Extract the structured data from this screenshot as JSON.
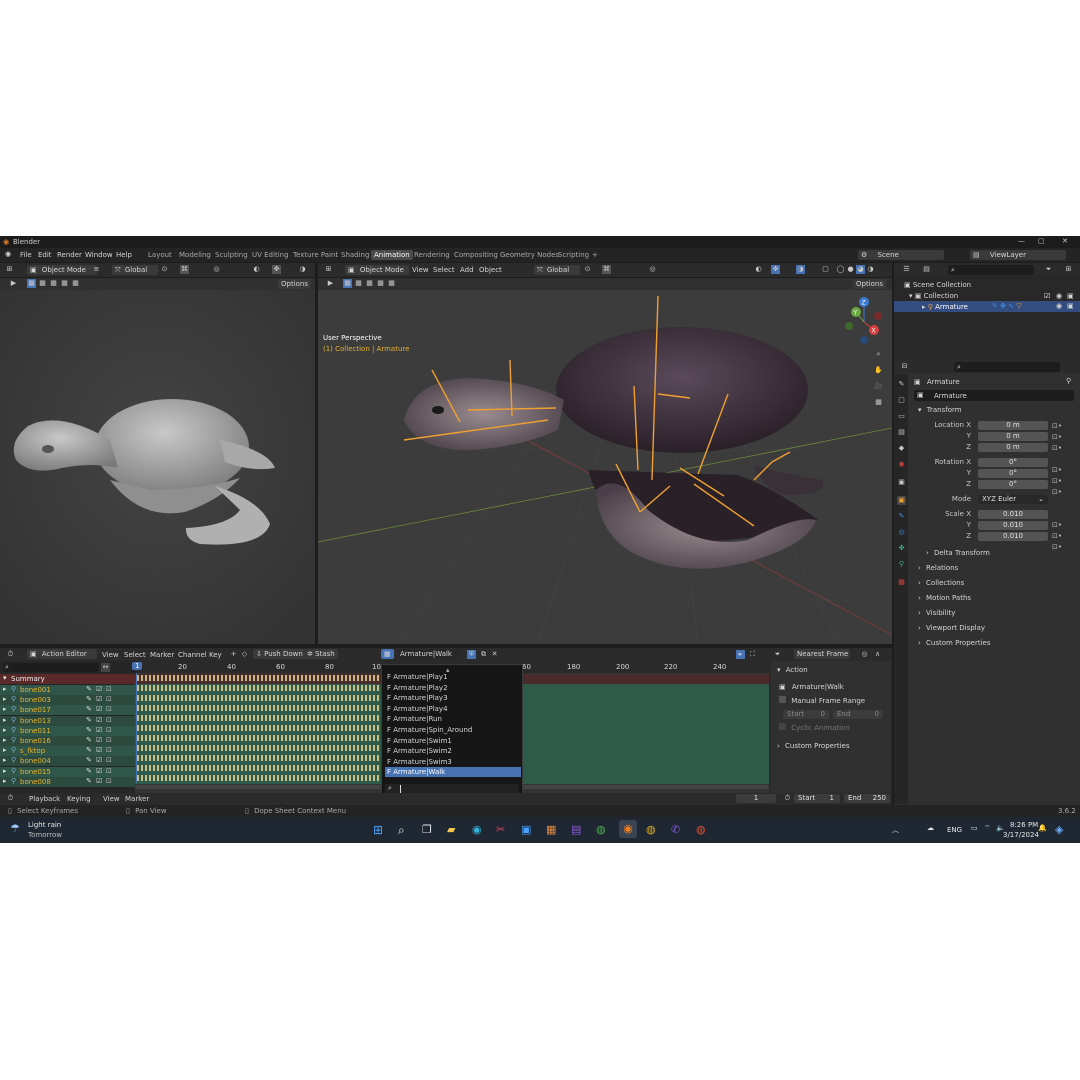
{
  "window": {
    "title": "Blender"
  },
  "menus": [
    "File",
    "Edit",
    "Render",
    "Window",
    "Help"
  ],
  "workspaces": [
    "Layout",
    "Modeling",
    "Sculpting",
    "UV Editing",
    "Texture Paint",
    "Shading",
    "Animation",
    "Rendering",
    "Compositing",
    "Geometry Nodes",
    "Scripting"
  ],
  "active_workspace": "Animation",
  "scene": {
    "name": "Scene",
    "view_layer": "ViewLayer"
  },
  "viewport_left": {
    "mode": "Object Mode",
    "orientation": "Global",
    "options": "Options"
  },
  "viewport_main": {
    "mode": "Object Mode",
    "menus": [
      "View",
      "Select",
      "Add",
      "Object"
    ],
    "orientation": "Global",
    "options": "Options",
    "overlay_title": "User Perspective",
    "overlay_sub": "(1) Collection | Armature",
    "gizmo": {
      "z": "Z",
      "y": "Y",
      "x": "X"
    }
  },
  "outliner": {
    "items": [
      "Scene Collection",
      "Collection",
      "Armature"
    ]
  },
  "properties": {
    "object_name": "Armature",
    "data_name": "Armature",
    "transform_header": "Transform",
    "location": {
      "label": "Location X",
      "x": "0 m",
      "y": "0 m",
      "z": "0 m"
    },
    "rotation": {
      "label": "Rotation X",
      "x": "0°",
      "y": "0°",
      "z": "0°"
    },
    "mode": {
      "label": "Mode",
      "value": "XYZ Euler"
    },
    "scale": {
      "label": "Scale X",
      "x": "0.010",
      "y": "0.010",
      "z": "0.010"
    },
    "axis_y": "Y",
    "axis_z": "Z",
    "sections": [
      "Delta Transform",
      "Relations",
      "Collections",
      "Motion Paths",
      "Visibility",
      "Viewport Display",
      "Custom Properties"
    ]
  },
  "dope_sheet": {
    "editor": "Action Editor",
    "menus": [
      "View",
      "Select",
      "Marker",
      "Channel",
      "Key"
    ],
    "push_down": "Push Down",
    "stash": "Stash",
    "action": "Armature|Walk",
    "snap": "Nearest Frame",
    "current_frame_marker": "1",
    "ruler": [
      "20",
      "40",
      "60",
      "80",
      "10",
      "60",
      "180",
      "200",
      "220",
      "240"
    ],
    "summary": "Summary",
    "channels": [
      "bone001",
      "bone003",
      "bone017",
      "bone013",
      "bone011",
      "bone016",
      "s_fktop",
      "bone004",
      "bone015",
      "bone008"
    ],
    "side_panel": {
      "action_header": "Action",
      "action_name": "Armature|Walk",
      "manual_range": "Manual Frame Range",
      "start": "Start",
      "start_val": "0",
      "end": "End",
      "end_val": "0",
      "cyclic": "Cyclic Animation",
      "custom": "Custom Properties"
    }
  },
  "action_dropdown": {
    "items": [
      "F Armature|Play1",
      "F Armature|Play2",
      "F Armature|Play3",
      "F Armature|Play4",
      "F Armature|Run",
      "F Armature|Spin_Around",
      "F Armature|Swim1",
      "F Armature|Swim2",
      "F Armature|Swim3",
      "F Armature|Walk"
    ],
    "selected": "F Armature|Walk"
  },
  "timeline": {
    "playback": "Playback",
    "keying": "Keying",
    "view": "View",
    "marker": "Marker",
    "frame": "1",
    "start_label": "Start",
    "start": "1",
    "end_label": "End",
    "end": "250"
  },
  "status": {
    "left": "Select Keyframes",
    "middle": "Pan View",
    "right": "Dope Sheet Context Menu",
    "version": "3.6.2"
  },
  "taskbar": {
    "weather": "Light rain",
    "weather_sub": "Tomorrow",
    "lang": "ENG",
    "time": "8:26 PM",
    "date": "3/17/2024"
  },
  "colors": {
    "accent": "#4772b3",
    "bone": "#f0a030",
    "keyframe": "#e7b32e",
    "channel_bg": "#2f5e4c"
  }
}
